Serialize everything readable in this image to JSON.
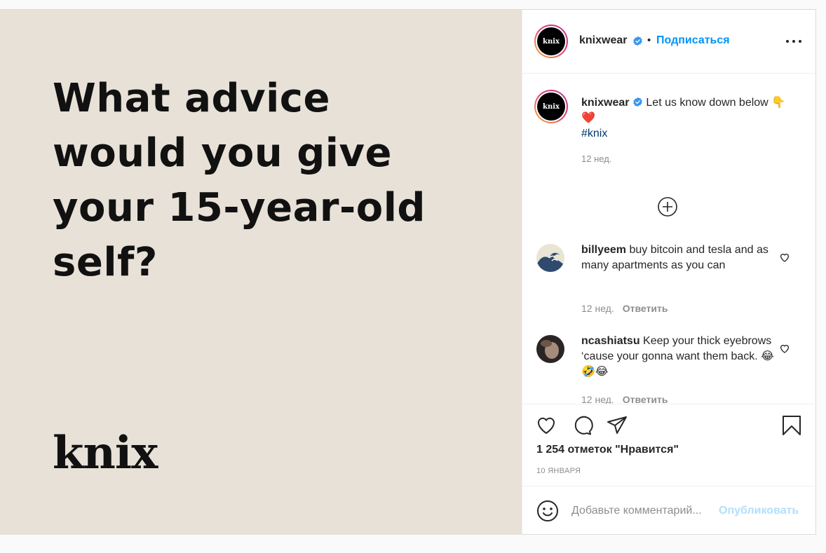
{
  "media": {
    "headline": [
      "What advice",
      "would you give",
      "your 15-year-old",
      "self?"
    ],
    "logo_text": "knix",
    "background_color": "#e8e1d8"
  },
  "header": {
    "avatar_text": "knix",
    "username": "knixwear",
    "separator": "•",
    "follow_label": "Подписаться",
    "more_icon": "more-horizontal-icon"
  },
  "caption": {
    "avatar_text": "knix",
    "username": "knixwear",
    "text": "Let us know down below 👇❤️",
    "hashtag": "#knix",
    "time": "12 нед.",
    "load_more_icon": "plus-circle-icon"
  },
  "comments": [
    {
      "username": "billyeem",
      "text": "buy bitcoin and tesla and as many apartments as you can",
      "time": "12 нед.",
      "reply_label": "Ответить"
    },
    {
      "username": "ncashiatsu",
      "text": "Keep your thick eyebrows ‘cause your gonna want them back. 😂🤣😂",
      "time": "12 нед.",
      "reply_label": "Ответить"
    }
  ],
  "actions": {
    "likes": "1 254 отметок \"Нравится\"",
    "date": "10 ЯНВАРЯ"
  },
  "composer": {
    "placeholder": "Добавьте комментарий...",
    "publish_label": "Опубликовать"
  },
  "colors": {
    "accent": "#0095f6",
    "publish_disabled": "#b2dffc",
    "hashtag": "#00376b",
    "muted": "#8e8e8e"
  }
}
